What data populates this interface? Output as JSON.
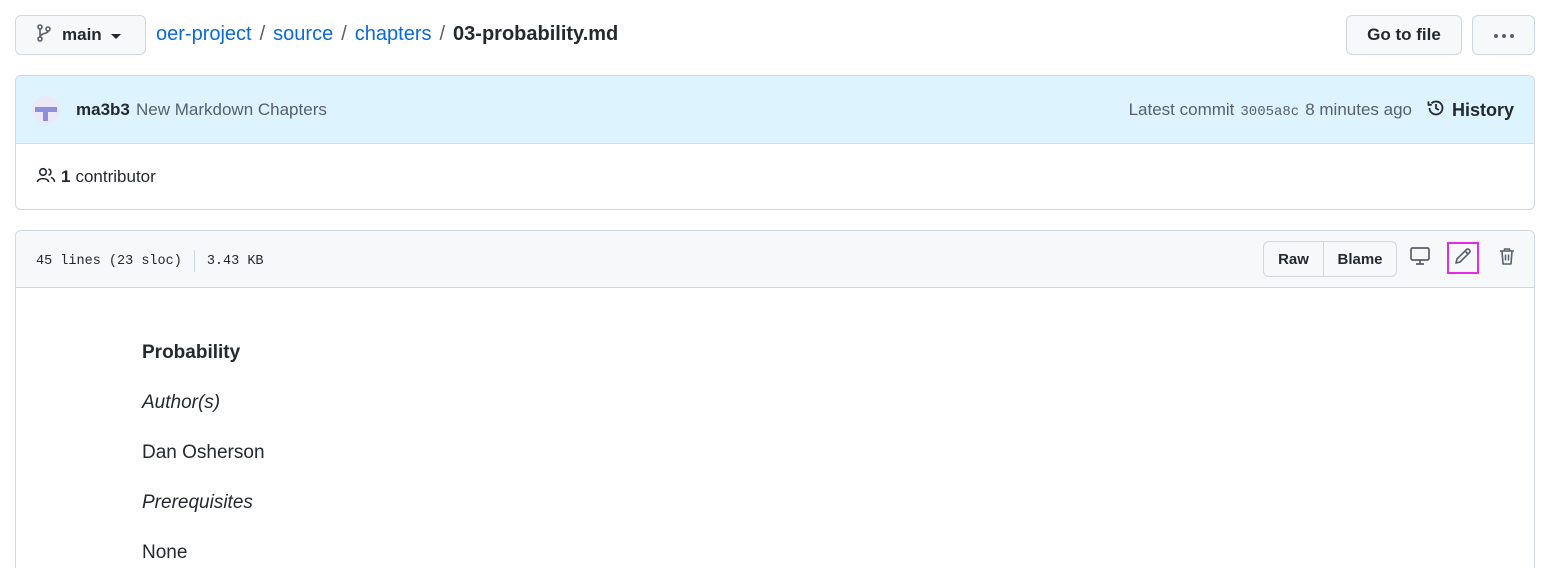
{
  "branch": {
    "label": "main",
    "icon": "git-branch-icon"
  },
  "breadcrumb": {
    "repo": "oer-project",
    "sep1": "/",
    "dir1": "source",
    "sep2": "/",
    "dir2": "chapters",
    "sep3": "/",
    "file": "03-probability.md"
  },
  "toolbar": {
    "goto_label": "Go to file",
    "more_label": "···"
  },
  "commit": {
    "author": "ma3b3",
    "message": "New Markdown Chapters",
    "latest_label": "Latest commit",
    "sha": "3005a8c",
    "time": "8 minutes ago",
    "history_label": "History"
  },
  "contributors": {
    "count": "1",
    "label": "contributor"
  },
  "file_header": {
    "lines": "45 lines (23 sloc)",
    "size": "3.43 KB",
    "raw_label": "Raw",
    "blame_label": "Blame"
  },
  "content": {
    "title": "Probability",
    "authors_label": "Author(s)",
    "author_name": "Dan Osherson",
    "prereq_label": "Prerequisites",
    "prereq_value": "None"
  },
  "colors": {
    "link": "#0969da",
    "commit_bg": "#ddf4ff",
    "highlight": "#e22ee2"
  }
}
